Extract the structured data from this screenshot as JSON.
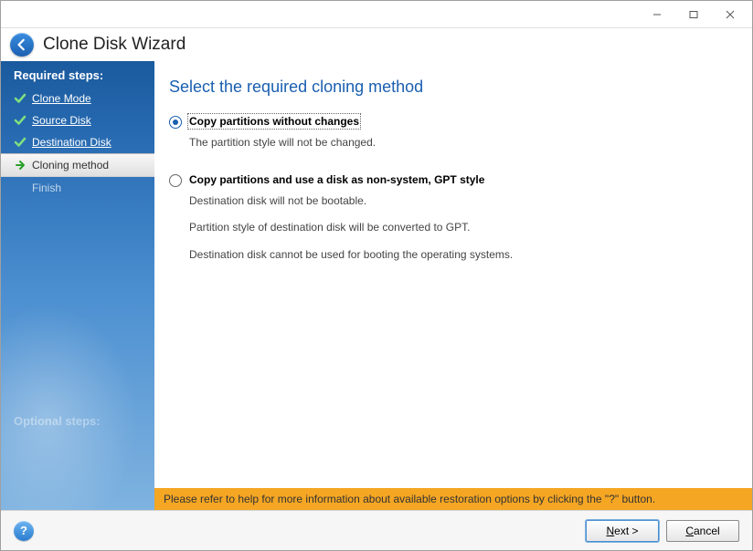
{
  "header": {
    "title": "Clone Disk Wizard"
  },
  "sidebar": {
    "heading": "Required steps:",
    "items": [
      {
        "label": "Clone Mode",
        "state": "done"
      },
      {
        "label": "Source Disk",
        "state": "done"
      },
      {
        "label": "Destination Disk",
        "state": "done"
      },
      {
        "label": "Cloning method",
        "state": "current"
      },
      {
        "label": "Finish",
        "state": "pending"
      }
    ],
    "optional_heading": "Optional steps:"
  },
  "main": {
    "heading": "Select the required cloning method",
    "options": [
      {
        "title": "Copy partitions without changes",
        "selected": true,
        "desc": [
          "The partition style will not be changed."
        ]
      },
      {
        "title": "Copy partitions and use a disk as non-system, GPT style",
        "selected": false,
        "desc": [
          "Destination disk will not be bootable.",
          "Partition style of destination disk will be converted to GPT.",
          "Destination disk cannot be used for booting the operating systems."
        ]
      }
    ],
    "info_bar": "Please refer to help for more information about available restoration options by clicking the \"?\" button."
  },
  "footer": {
    "next_prefix": "N",
    "next_suffix": "ext >",
    "cancel_prefix": "C",
    "cancel_suffix": "ancel",
    "help": "?"
  }
}
